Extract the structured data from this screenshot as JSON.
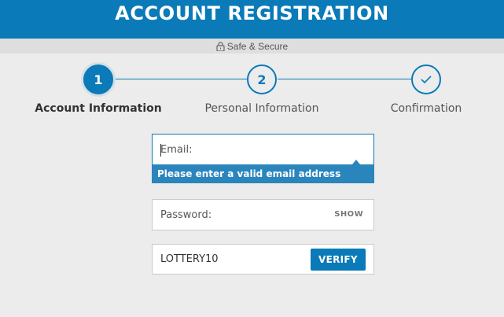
{
  "header": {
    "title": "ACCOUNT REGISTRATION"
  },
  "security": {
    "label": "Safe & Secure",
    "icon": "lock-icon"
  },
  "steps": [
    {
      "number": "1",
      "label": "Account Information",
      "state": "active"
    },
    {
      "number": "2",
      "label": "Personal Information",
      "state": "pending"
    },
    {
      "icon": "checkmark-icon",
      "label": "Confirmation",
      "state": "pending"
    }
  ],
  "form": {
    "email": {
      "placeholder": "Email:",
      "value": "",
      "error": "Please enter a valid email address"
    },
    "password": {
      "placeholder": "Password:",
      "toggle_label": "SHOW"
    },
    "promo": {
      "value": "LOTTERY10",
      "button_label": "VERIFY"
    }
  },
  "colors": {
    "brand": "#0a7ab8",
    "error_bg": "#2b85bd",
    "background": "#ececec"
  }
}
